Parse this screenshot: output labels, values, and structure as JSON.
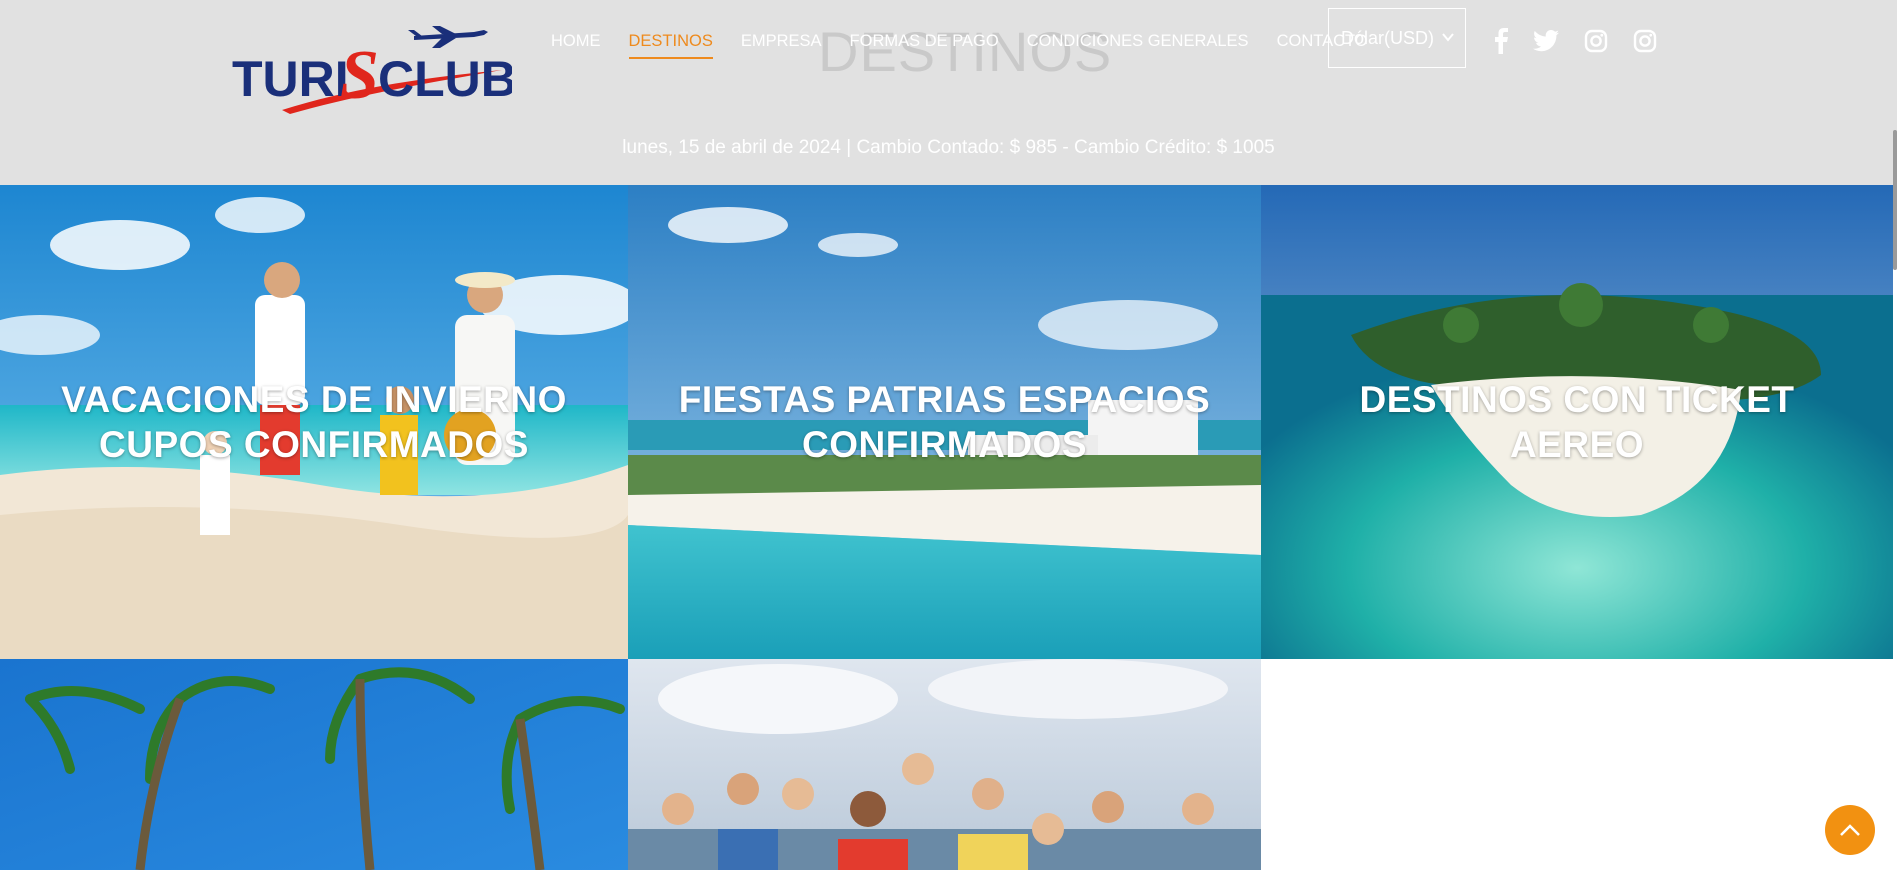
{
  "header": {
    "page_title": "DESTINOS",
    "logo": {
      "part1": "TURI",
      "part2": "S",
      "part3": "CLUB"
    },
    "nav": [
      {
        "label": "HOME"
      },
      {
        "label": "DESTINOS"
      },
      {
        "label": "EMPRESA"
      },
      {
        "label": "FORMAS DE PAGO"
      },
      {
        "label": "CONDICIONES GENERALES"
      },
      {
        "label": "CONTACTO"
      }
    ],
    "currency": {
      "selected": "Dólar(USD)"
    },
    "social_icons": [
      "facebook-icon",
      "twitter-icon",
      "instagram-icon",
      "instagram-icon"
    ],
    "info_bar": "lunes, 15 de abril de 2024 | Cambio Contado: $ 985 - Cambio Crédito: $ 1005"
  },
  "tiles": [
    {
      "caption": "VACACIONES DE INVIERNO CUPOS CONFIRMADOS"
    },
    {
      "caption": "FIESTAS PATRIAS ESPACIOS CONFIRMADOS"
    },
    {
      "caption": "DESTINOS CON TICKET AEREO"
    },
    {
      "caption": ""
    },
    {
      "caption": ""
    }
  ],
  "colors": {
    "accent": "#ee8a1d",
    "header_bg": "#e1e1e1",
    "logo_blue": "#1a2f7a",
    "logo_red": "#e0261c",
    "back_to_top": "#f29111"
  }
}
